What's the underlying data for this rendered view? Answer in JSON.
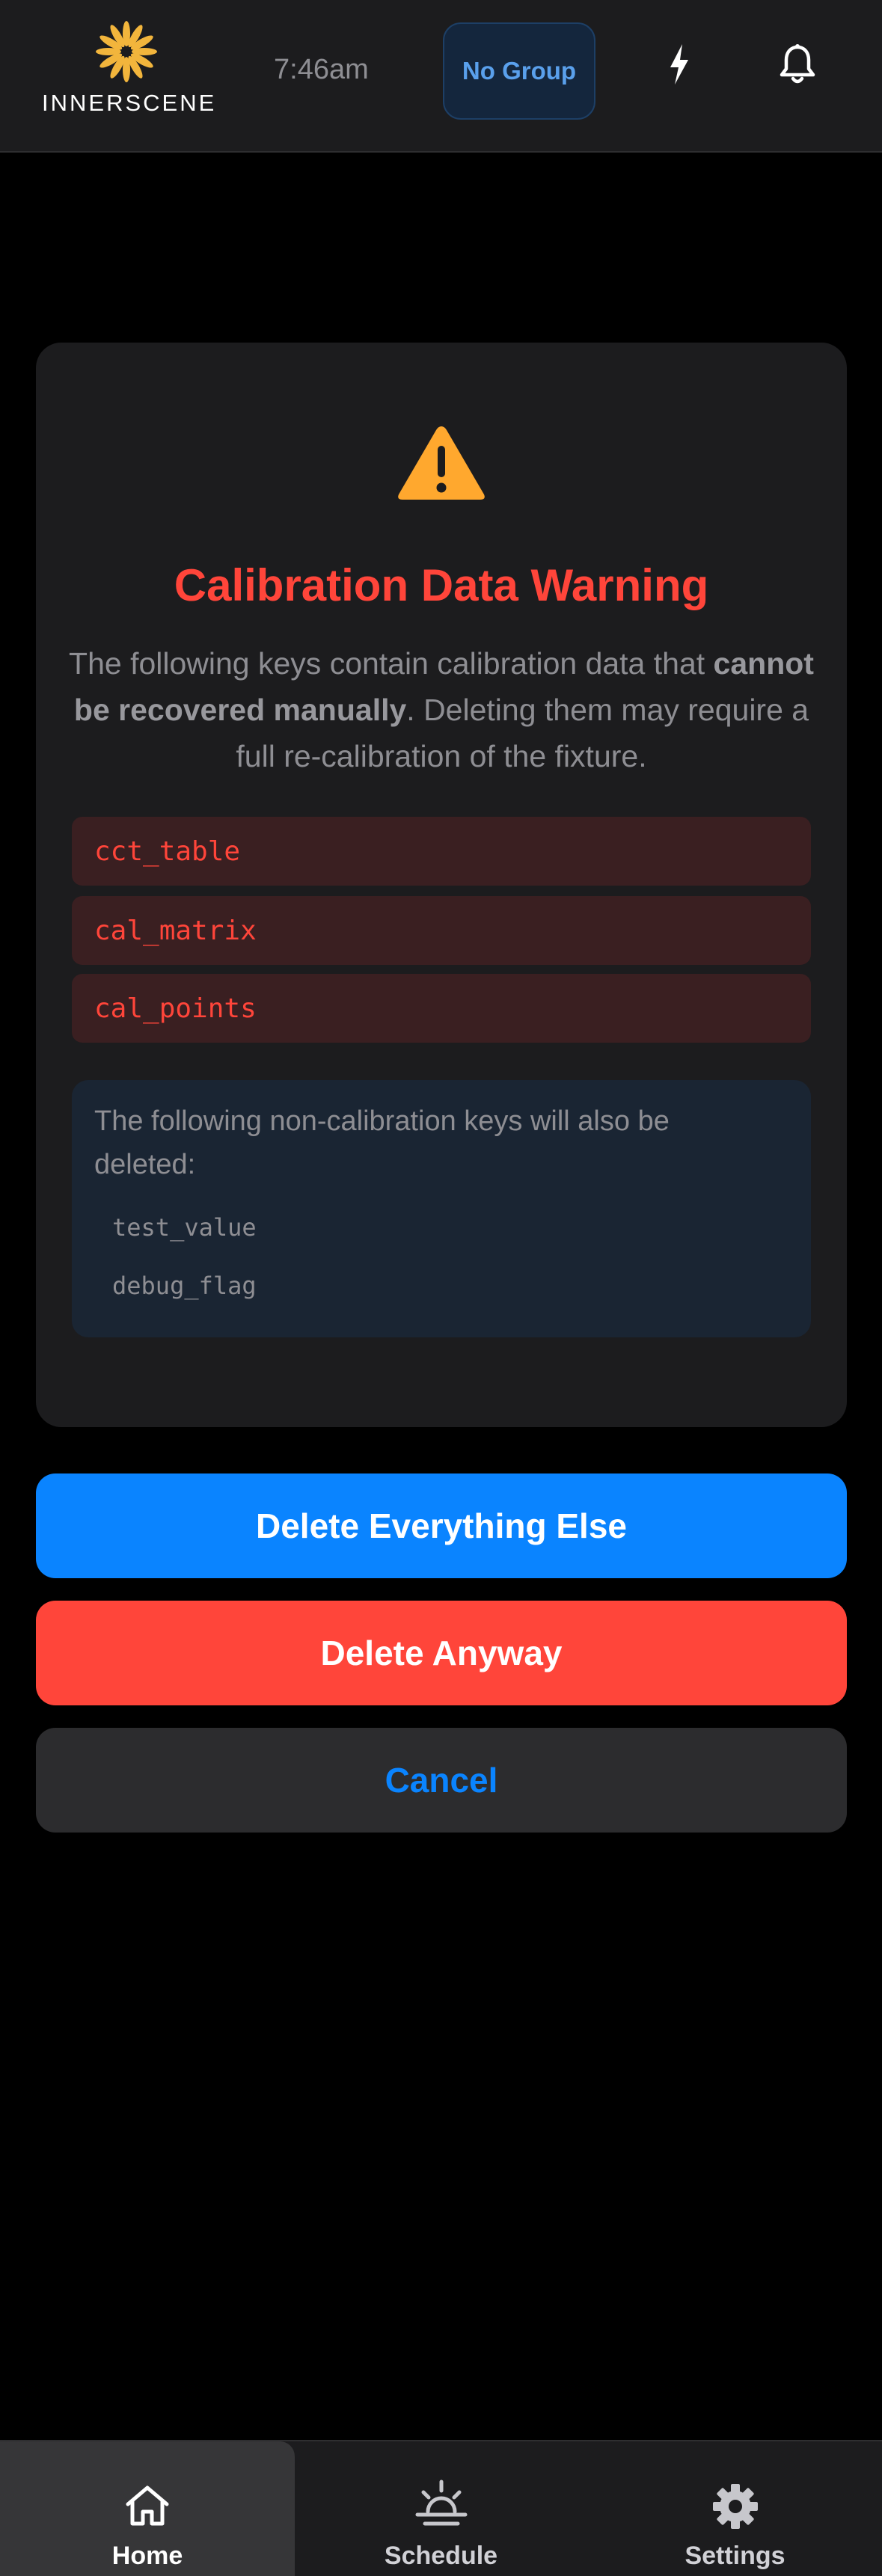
{
  "header": {
    "logo_text": "INNERSCENE",
    "time": "7:46am",
    "group_button": "No Group",
    "icons": [
      "flash-icon",
      "bell-icon"
    ]
  },
  "modal": {
    "icon": "warning-triangle-icon",
    "title": "Calibration Data Warning",
    "description_pre": "The following keys contain calibration data that ",
    "description_bold": "cannot be recovered manually",
    "description_post": ". Deleting them may require a full re-calibration of the fixture.",
    "calibration_keys": [
      "cct_table",
      "cal_matrix",
      "cal_points"
    ],
    "noncal_text": "The following non-calibration keys will also be deleted:",
    "noncal_keys": [
      "test_value",
      "debug_flag"
    ]
  },
  "actions": {
    "primary": "Delete Everything Else",
    "danger": "Delete Anyway",
    "cancel": "Cancel"
  },
  "nav": {
    "items": [
      {
        "label": "Home",
        "icon": "home-icon",
        "active": true
      },
      {
        "label": "Schedule",
        "icon": "sunrise-icon",
        "active": false
      },
      {
        "label": "Settings",
        "icon": "gear-icon",
        "active": false
      }
    ]
  },
  "colors": {
    "accent": "#0a84ff",
    "danger": "#ff453a",
    "warning": "#ffa82e",
    "logo": "#f2b53c"
  }
}
